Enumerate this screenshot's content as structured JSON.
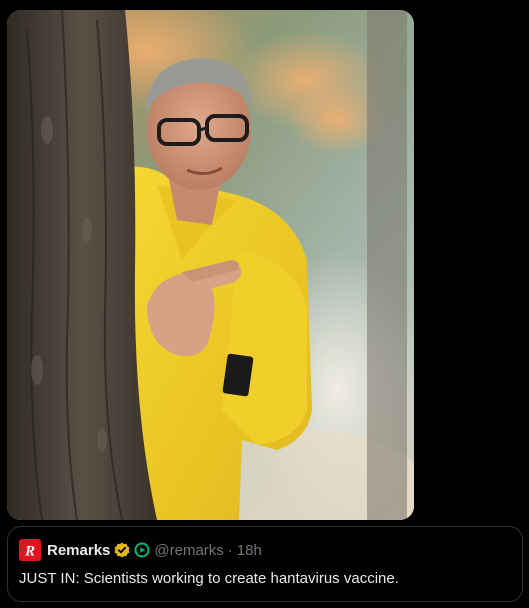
{
  "media": {
    "icon": "photo"
  },
  "quote": {
    "avatar_icon": "remarks-logo-icon",
    "display_name": "Remarks",
    "verified_icon": "gold-verified-badge-icon",
    "affiliate_icon": "green-play-badge-icon",
    "handle": "@remarks",
    "separator": "·",
    "timestamp": "18h",
    "text": "JUST IN: Scientists working to create hantavirus vaccine."
  },
  "colors": {
    "background": "#000000",
    "border": "#2f3336",
    "text_primary": "#e7e9ea",
    "text_secondary": "#71767b",
    "brand_red": "#e0141e",
    "verified_gold": "#e2b719",
    "badge_green": "#00ba7c",
    "jacket_yellow": "#f2d02a"
  }
}
